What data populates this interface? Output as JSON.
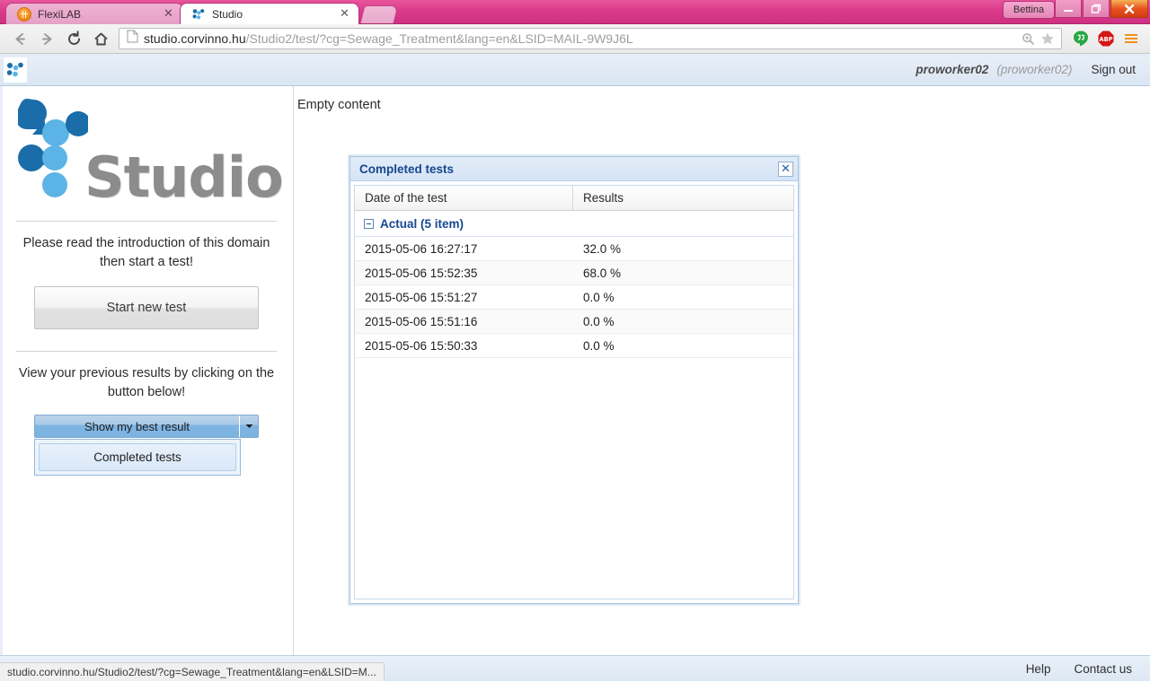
{
  "browser": {
    "tabs": [
      {
        "title": "FlexiLAB",
        "favicon": "flexilab-icon",
        "active": false
      },
      {
        "title": "Studio",
        "favicon": "studio-icon",
        "active": true
      }
    ],
    "new_tab_label": "",
    "window": {
      "user_button": "Bettina",
      "minimize": "–",
      "maximize": "❐",
      "close": "✕"
    },
    "toolbar": {
      "back": "←",
      "forward": "→",
      "reload": "⟳",
      "home": "⌂",
      "url_host": "studio.corvinno.hu",
      "url_path": "/Studio2/test/?cg=Sewage_Treatment&lang=en&LSID=MAIL-9W9J6L",
      "url_full": "studio.corvinno.hu/Studio2/test/?cg=Sewage_Treatment&lang=en&LSID=MAIL-9W9J6L",
      "zoom_label": "zoom-icon",
      "bookmark_label": "star-icon",
      "extensions": [
        "hangouts-icon",
        "adblockplus-icon"
      ],
      "menu_label": "hamburger-menu-icon"
    },
    "status_bar": "studio.corvinno.hu/Studio2/test/?cg=Sewage_Treatment&lang=en&LSID=M..."
  },
  "header": {
    "logo": "studio-dots-logo",
    "username": "proworker02",
    "userid": "(proworker02)",
    "signout": "Sign out"
  },
  "sidebar": {
    "wordmark": "Studio",
    "intro_text": "Please read the introduction of this domain then start a test!",
    "start_test_label": "Start new test",
    "results_text": "View your previous results by clicking on the button below!",
    "split_button_label": "Show my best result",
    "split_button_arrow": "▼",
    "dropdown_items": [
      "Completed tests"
    ]
  },
  "main": {
    "empty_content": "Empty content"
  },
  "dialog": {
    "title": "Completed tests",
    "close_label": "✕",
    "columns": [
      "Date of the test",
      "Results"
    ],
    "group": {
      "label": "Actual (5 item)",
      "expanded": true,
      "count": 5
    },
    "rows": [
      {
        "date": "2015-05-06 16:27:17",
        "result": "32.0 %"
      },
      {
        "date": "2015-05-06 15:52:35",
        "result": "68.0 %"
      },
      {
        "date": "2015-05-06 15:51:27",
        "result": "0.0 %"
      },
      {
        "date": "2015-05-06 15:51:16",
        "result": "0.0 %"
      },
      {
        "date": "2015-05-06 15:50:33",
        "result": "0.0 %"
      }
    ]
  },
  "footer": {
    "links": [
      "Help",
      "Contact us"
    ]
  },
  "colors": {
    "browser_accent": "#d93b8a",
    "studio_blue_dark": "#1a6da8",
    "studio_blue_light": "#5bb4e5",
    "dialog_title_blue": "#15478f",
    "split_button_blue": "#7db3e1"
  }
}
